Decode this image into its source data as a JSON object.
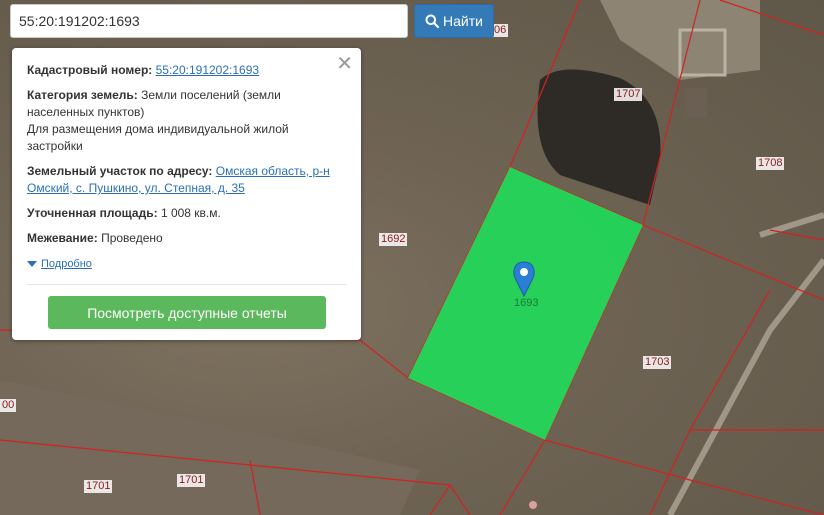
{
  "search": {
    "value": "55:20:191202:1693",
    "button_label": "Найти"
  },
  "info_card": {
    "cadastral_label": "Кадастровый номер:",
    "cadastral_value": "55:20:191202:1693",
    "category_label": "Категория земель:",
    "category_value": "Земли поселений (земли населенных пунктов)",
    "usage": "Для размещения дома индивидуальной жилой застройки",
    "address_label": "Земельный участок по адресу:",
    "address_value": "Омская область, р-н Омский, с. Пушкино, ул. Степная, д. 35",
    "area_label": "Уточненная площадь:",
    "area_value": "1 008 кв.м.",
    "survey_label": "Межевание:",
    "survey_value": "Проведено",
    "details_label": "Подробно",
    "reports_button": "Посмотреть доступные отчеты"
  },
  "map": {
    "parcel_labels": {
      "p1706": "06",
      "p1707": "1707",
      "p1708": "1708",
      "p1692": "1692",
      "p1693": "1693",
      "p1703": "1703",
      "p1701a": "1701",
      "p1701b": "1701",
      "p00": "00"
    },
    "colors": {
      "selected_parcel": "#22d65a",
      "boundary": "#d42020",
      "marker": "#2a7fd4"
    }
  }
}
